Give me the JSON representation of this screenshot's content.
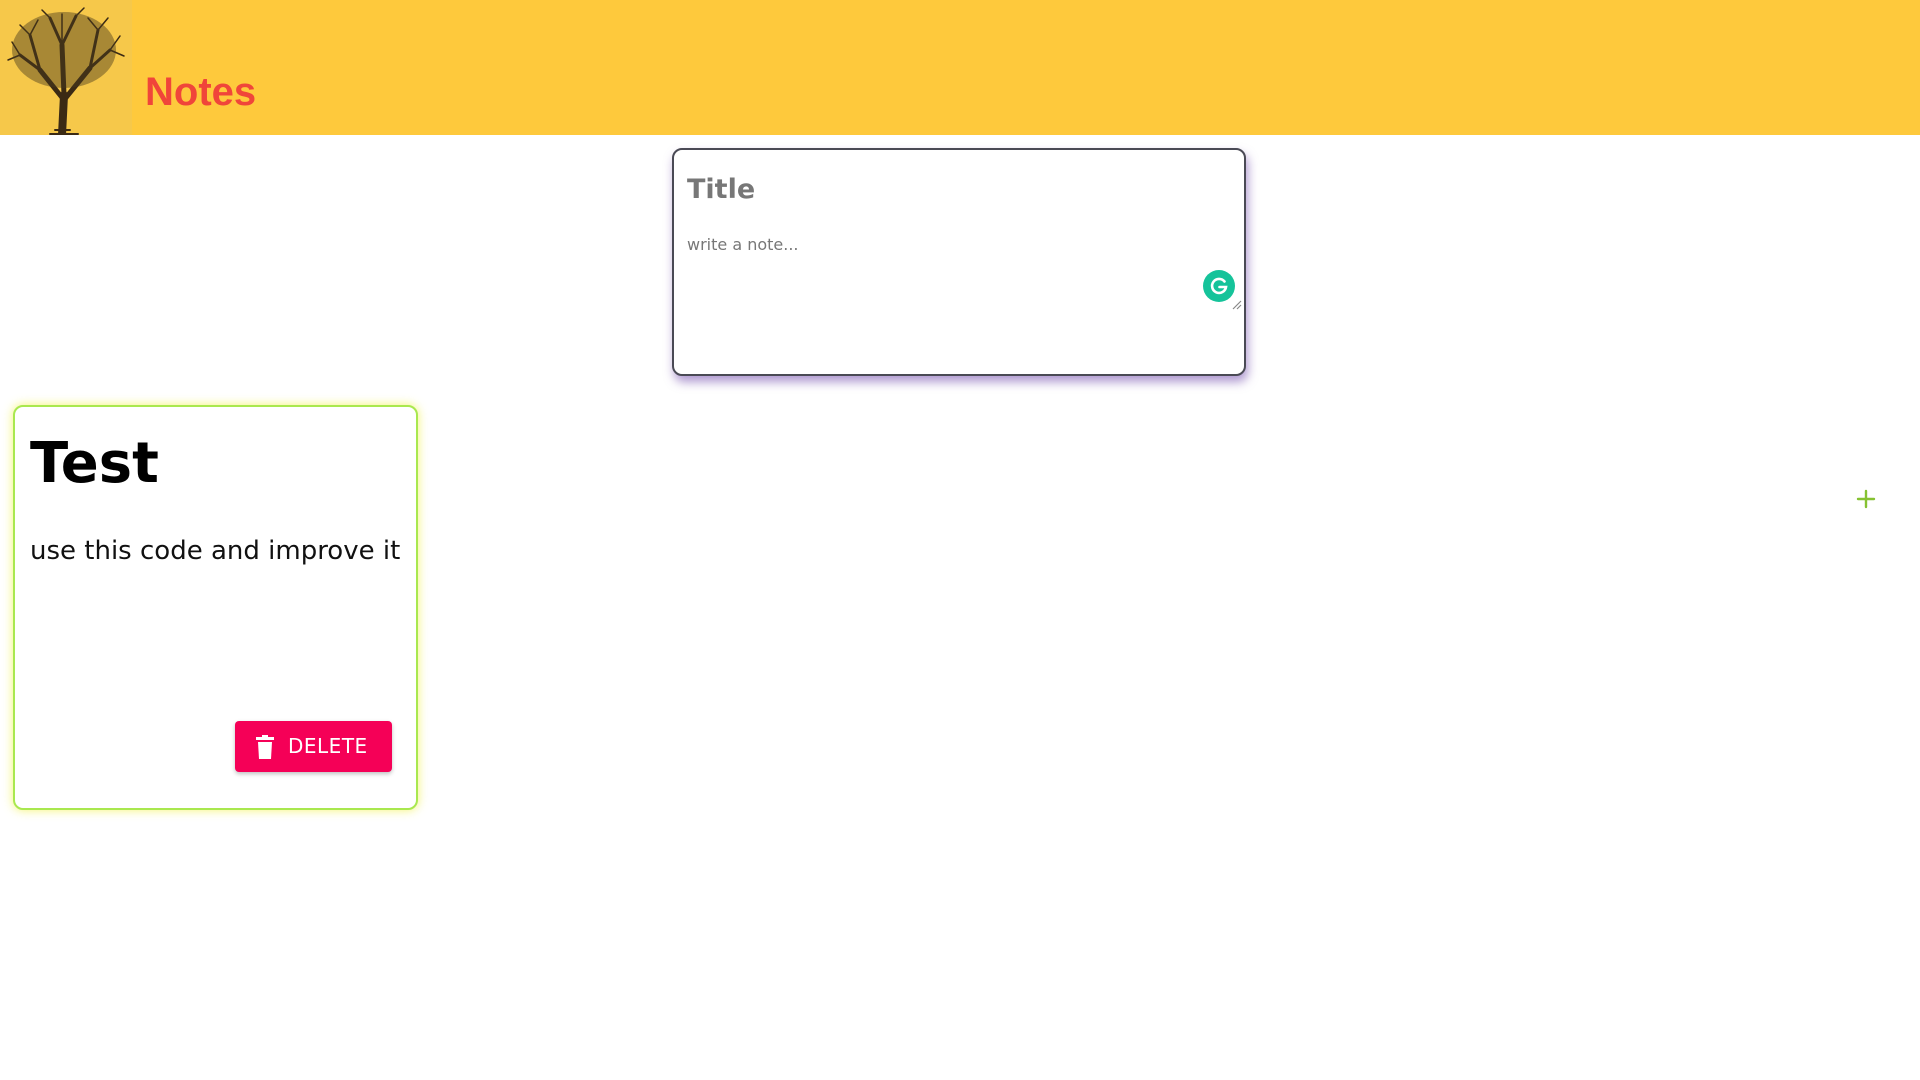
{
  "header": {
    "logo_icon": "tree-icon",
    "title": "Notes",
    "background": "#fec93c",
    "title_color": "#f0453a"
  },
  "composer": {
    "title_placeholder": "Title",
    "body_placeholder": "write a note...",
    "grammarly_icon": "grammarly-icon",
    "add_icon": "plus-icon",
    "add_color": "#86c232"
  },
  "notes": [
    {
      "title": "Test",
      "content": "use this code and improve it",
      "delete_label": "DELETE",
      "delete_icon": "trash-icon",
      "delete_color": "#f50057"
    }
  ]
}
